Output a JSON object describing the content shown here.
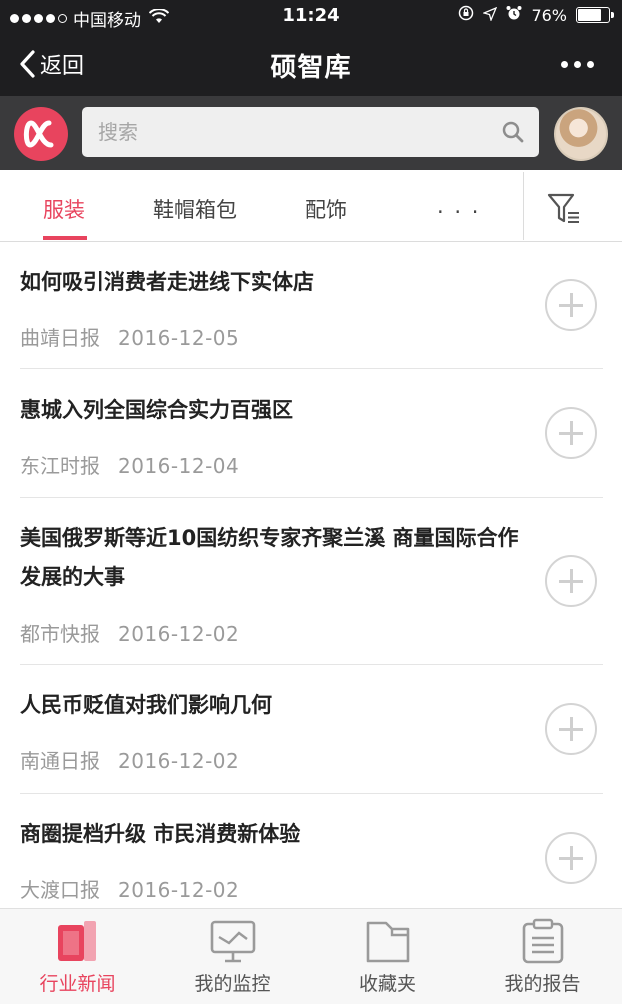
{
  "status_bar": {
    "carrier": "中国移动",
    "time": "11:24",
    "battery": "76%",
    "battery_level": 0.76
  },
  "nav": {
    "back_label": "返回",
    "title": "硕智库"
  },
  "search": {
    "placeholder": "搜索"
  },
  "tabs": [
    {
      "label": "服装",
      "active": true
    },
    {
      "label": "鞋帽箱包",
      "active": false
    },
    {
      "label": "配饰",
      "active": false
    },
    {
      "label": ". . .",
      "active": false
    }
  ],
  "articles": [
    {
      "title": "如何吸引消费者走进线下实体店",
      "source": "曲靖日报",
      "date": "2016-12-05"
    },
    {
      "title": "惠城入列全国综合实力百强区",
      "source": "东江时报",
      "date": "2016-12-04"
    },
    {
      "title": "美国俄罗斯等近10国纺织专家齐聚兰溪 商量国际合作发展的大事",
      "source": "都市快报",
      "date": "2016-12-02"
    },
    {
      "title": "人民币贬值对我们影响几何",
      "source": "南通日报",
      "date": "2016-12-02"
    },
    {
      "title": "商圈提档升级 市民消费新体验",
      "source": "大渡口报",
      "date": "2016-12-02"
    }
  ],
  "tab_bar": [
    {
      "label": "行业新闻",
      "icon": "industry-news-icon",
      "active": true
    },
    {
      "label": "我的监控",
      "icon": "monitor-icon",
      "active": false
    },
    {
      "label": "收藏夹",
      "icon": "folder-icon",
      "active": false
    },
    {
      "label": "我的报告",
      "icon": "report-icon",
      "active": false
    }
  ],
  "colors": {
    "accent": "#e8445e",
    "nav_bg": "#1e1e20",
    "search_row_bg": "#3a3a3c"
  }
}
